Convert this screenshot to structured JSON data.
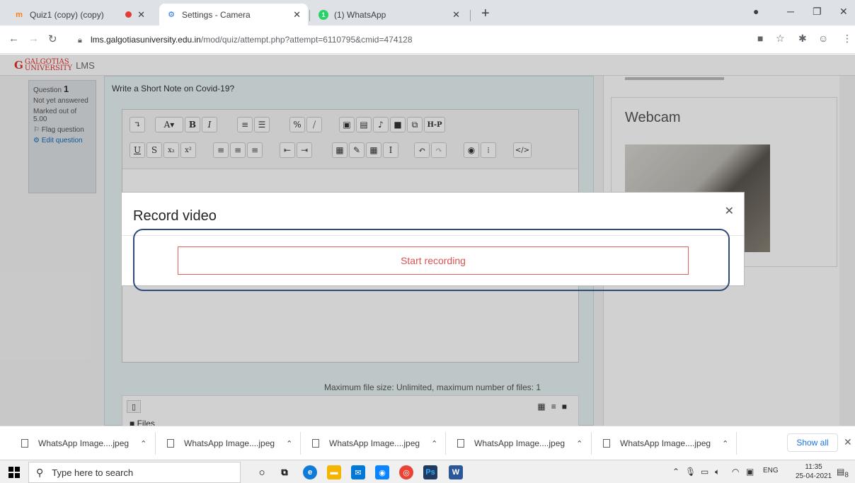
{
  "browser": {
    "tabs": [
      {
        "title": "Quiz1 (copy) (copy)",
        "icon": "moodle-icon"
      },
      {
        "title": "Settings - Camera",
        "icon": "gear-icon"
      },
      {
        "title": "(1) WhatsApp",
        "icon": "whatsapp-icon"
      }
    ],
    "url_host": "lms.galgotiasuniversity.edu.in",
    "url_path": "/mod/quiz/attempt.php?attempt=6110795&cmid=474128"
  },
  "lms": {
    "logo_text": "GALGOTIAS",
    "logo_sub": "UNIVERSITY",
    "lms_label": "LMS"
  },
  "question_info": {
    "question_label": "Question",
    "question_number": "1",
    "status": "Not yet answered",
    "marked": "Marked out of 5.00",
    "flag": "Flag question",
    "edit": "Edit question"
  },
  "question": {
    "text": "Write a Short Note on Covid-19?",
    "max_file_size": "Maximum file size: Unlimited, maximum number of files: 1",
    "files_label": "Files"
  },
  "webcam": {
    "title": "Webcam"
  },
  "modal": {
    "title": "Record video",
    "start_label": "Start recording"
  },
  "downloads": {
    "items": [
      "WhatsApp Image....jpeg",
      "WhatsApp Image....jpeg",
      "WhatsApp Image....jpeg",
      "WhatsApp Image....jpeg",
      "WhatsApp Image....jpeg"
    ],
    "show_all": "Show all"
  },
  "taskbar": {
    "search_placeholder": "Type here to search",
    "lang": "ENG",
    "time": "11:35",
    "date": "25-04-2021",
    "notifications": "8"
  }
}
